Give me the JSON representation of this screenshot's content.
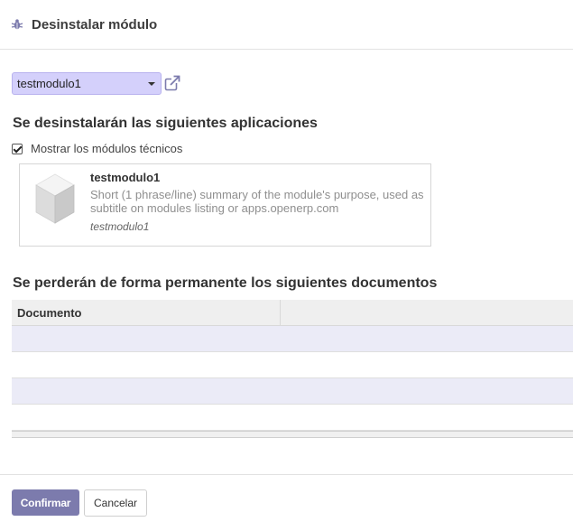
{
  "dialog": {
    "title": "Desinstalar módulo",
    "icon": "bug-icon"
  },
  "module_select": {
    "value": "testmodulo1",
    "external_link_icon": "external-link-icon"
  },
  "apps_section": {
    "heading": "Se desinstalarán las siguientes aplicaciones",
    "show_technical_label": "Mostrar los módulos técnicos",
    "show_technical_checked": true,
    "module_card": {
      "name": "testmodulo1",
      "summary": "Short (1 phrase/line) summary of the module's purpose, used as subtitle on modules listing or apps.openerp.com",
      "technical_name": "testmodulo1",
      "icon": "module-cube-icon"
    }
  },
  "docs_section": {
    "heading": "Se perderán de forma permanente los siguientes documentos",
    "columns": [
      "Documento",
      ""
    ],
    "rows": []
  },
  "footer": {
    "confirm_label": "Confirmar",
    "cancel_label": "Cancelar"
  },
  "colors": {
    "accent": "#7c7bad",
    "select_bg": "#d4d0fb",
    "row_stripe": "#ebebf7"
  }
}
